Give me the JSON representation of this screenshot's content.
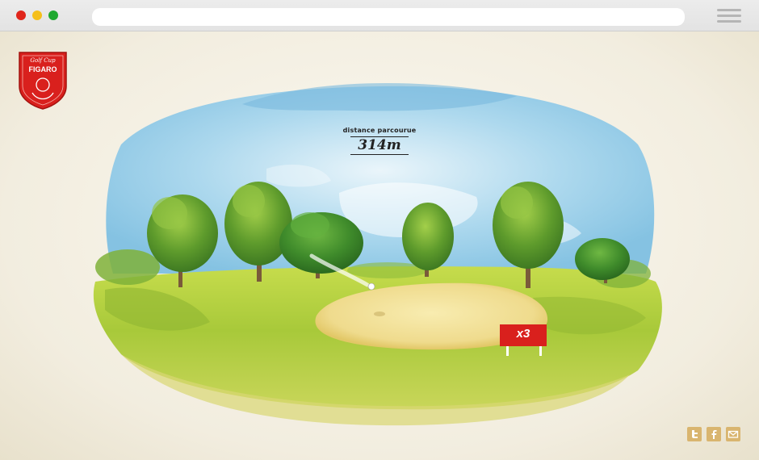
{
  "browser": {
    "url": ""
  },
  "logo": {
    "script": "Golf Cup",
    "name": "FIGARO"
  },
  "hud": {
    "distance_label": "distance parcourue",
    "distance_value": "314m"
  },
  "bonus": {
    "multiplier": "x3"
  },
  "social": [
    {
      "icon": "twitter-icon"
    },
    {
      "icon": "facebook-icon"
    },
    {
      "icon": "mail-icon"
    }
  ],
  "colors": {
    "brand_red": "#d9201d",
    "sky": "#8cc8e6",
    "grass": "#9cc236",
    "sand": "#f3e39a",
    "social_gold": "#d9b56f"
  }
}
